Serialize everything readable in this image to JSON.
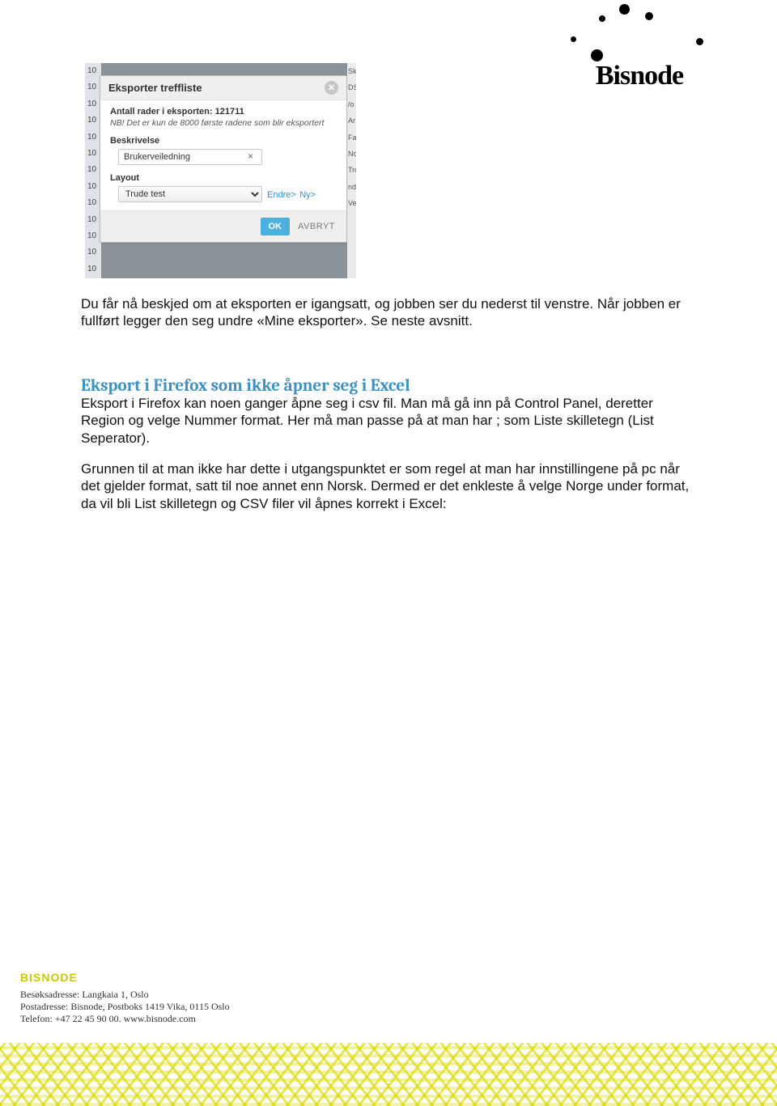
{
  "logo": {
    "text": "Bisnode"
  },
  "screenshot": {
    "bg_rows": [
      "10",
      "10",
      "10",
      "10",
      "10",
      "10",
      "10",
      "10",
      "10",
      "10",
      "10",
      "10",
      "10"
    ],
    "bg_right": [
      "",
      "Sk",
      "DS",
      "/o",
      "",
      "",
      "Ar",
      "Fa",
      "No",
      "",
      "Tro",
      "nd",
      "Ve"
    ],
    "dialog": {
      "title": "Eksporter treffliste",
      "rows_label": "Antall rader i eksporten:",
      "rows_value": "121711",
      "note": "NB! Det er kun de 8000 første radene som blir eksportert",
      "desc_label": "Beskrivelse",
      "desc_value": "Brukerveiledning",
      "layout_label": "Layout",
      "layout_value": "Trude test",
      "link_edit": "Endre>",
      "link_new": "Ny>",
      "ok": "OK",
      "cancel": "AVBRYT"
    }
  },
  "body": {
    "p1": "Du får nå beskjed om at eksporten er igangsatt, og jobben ser du nederst til venstre. Når jobben er fullført legger den seg undre «Mine eksporter». Se neste avsnitt.",
    "h2": "Eksport i Firefox som ikke åpner seg i Excel",
    "p2": "Eksport i Firefox kan noen ganger åpne seg i csv fil. Man må gå inn på Control Panel, deretter Region og velge Nummer format. Her må man passe på at man har ; som Liste skilletegn (List Seperator).",
    "p3": "Grunnen til at man ikke har dette i utgangspunktet er som regel at man har innstillingene på pc når det gjelder format, satt til noe annet enn Norsk. Dermed er det enkleste å velge Norge under format, da vil bli List skilletegn og CSV filer vil åpnes korrekt i Excel:"
  },
  "footer": {
    "brand": "BISNODE",
    "addr1": "Besøksadresse: Langkaia 1, Oslo",
    "addr2": "Postadresse: Bisnode, Postboks 1419 Vika, 0115 Oslo",
    "addr3": "Telefon: +47 22 45 90 00. www.bisnode.com"
  }
}
